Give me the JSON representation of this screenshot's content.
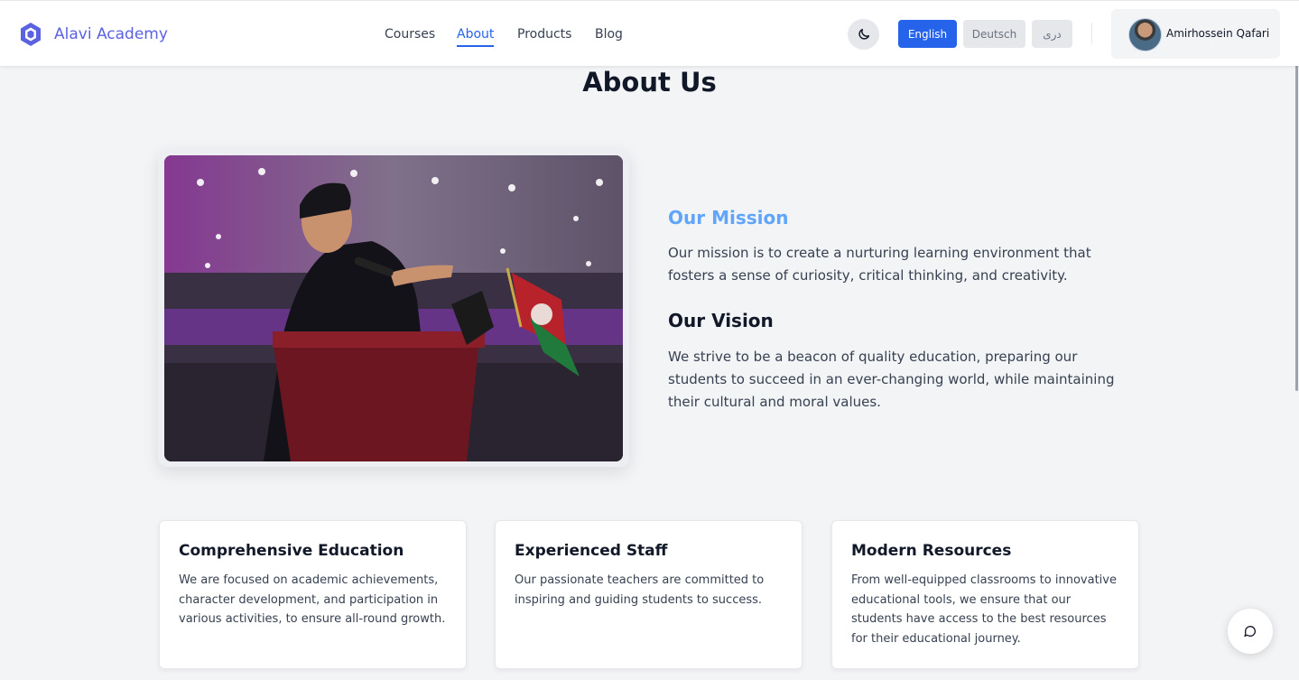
{
  "header": {
    "brand": "Alavi Academy",
    "nav": [
      {
        "label": "Courses",
        "active": false
      },
      {
        "label": "About",
        "active": true
      },
      {
        "label": "Products",
        "active": false
      },
      {
        "label": "Blog",
        "active": false
      }
    ],
    "theme_icon": "moon-icon",
    "languages": [
      {
        "label": "English",
        "selected": true
      },
      {
        "label": "Deutsch",
        "selected": false
      },
      {
        "label": "دری",
        "selected": false
      }
    ],
    "user": {
      "name": "Amirhossein Qafari"
    }
  },
  "main": {
    "title": "About Us",
    "mission": {
      "heading": "Our Mission",
      "text": "Our mission is to create a nurturing learning environment that fosters a sense of curiosity, critical thinking, and creativity."
    },
    "vision": {
      "heading": "Our Vision",
      "text": "We strive to be a beacon of quality education, preparing our students to succeed in an ever-changing world, while maintaining their cultural and moral values."
    },
    "cards": [
      {
        "title": "Comprehensive Education",
        "text": "We are focused on academic achievements, character development, and participation in various activities, to ensure all-round growth."
      },
      {
        "title": "Experienced Staff",
        "text": "Our passionate teachers are committed to inspiring and guiding students to success."
      },
      {
        "title": "Modern Resources",
        "text": "From well-equipped classrooms to innovative educational tools, we ensure that our students have access to the best resources for their educational journey."
      }
    ]
  },
  "colors": {
    "accent": "#2563eb",
    "brand": "#5b62e0",
    "mission_heading": "#60a5fa",
    "background": "#f3f4f6"
  },
  "chat_icon": "chat-bubble-icon"
}
